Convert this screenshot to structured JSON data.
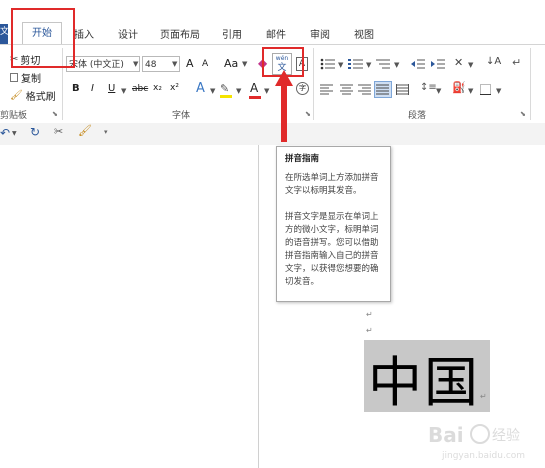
{
  "tabs": {
    "file": "文",
    "home": "开始",
    "insert": "插入",
    "design": "设计",
    "layout": "页面布局",
    "references": "引用",
    "mailings": "邮件",
    "review": "审阅",
    "view": "视图"
  },
  "clipboard": {
    "cut": "剪切",
    "copy": "复制",
    "format_painter": "格式刷",
    "group_label": "剪贴板"
  },
  "font": {
    "font_name": "宋体 (中文正)",
    "font_size": "48",
    "group_label": "字体",
    "bold": "B",
    "italic": "I",
    "underline": "U",
    "strikethrough": "abc",
    "subscript": "x₂",
    "superscript": "x²",
    "change_case": "Aa",
    "grow_font": "A",
    "shrink_font": "A",
    "text_effects": "A",
    "font_color": "A"
  },
  "phonetic_guide": {
    "icon_text": "wén",
    "char": "文",
    "enclose_char": "字"
  },
  "paragraph": {
    "group_label": "段落"
  },
  "tooltip": {
    "title": "拼音指南",
    "line1": "在所选单词上方添加拼音文字以标明其发音。",
    "line2": "拼音文字是显示在单词上方的微小文字，标明单词的语音拼写。您可以借助拼音指南输入自己的拼音文字，以获得您想要的确切发音。"
  },
  "document": {
    "big_text": "中国",
    "return_mark": "↵"
  },
  "colors": {
    "accent": "#2b579a",
    "highlight": "#e02a2a",
    "selection": "#c8c8c8"
  }
}
